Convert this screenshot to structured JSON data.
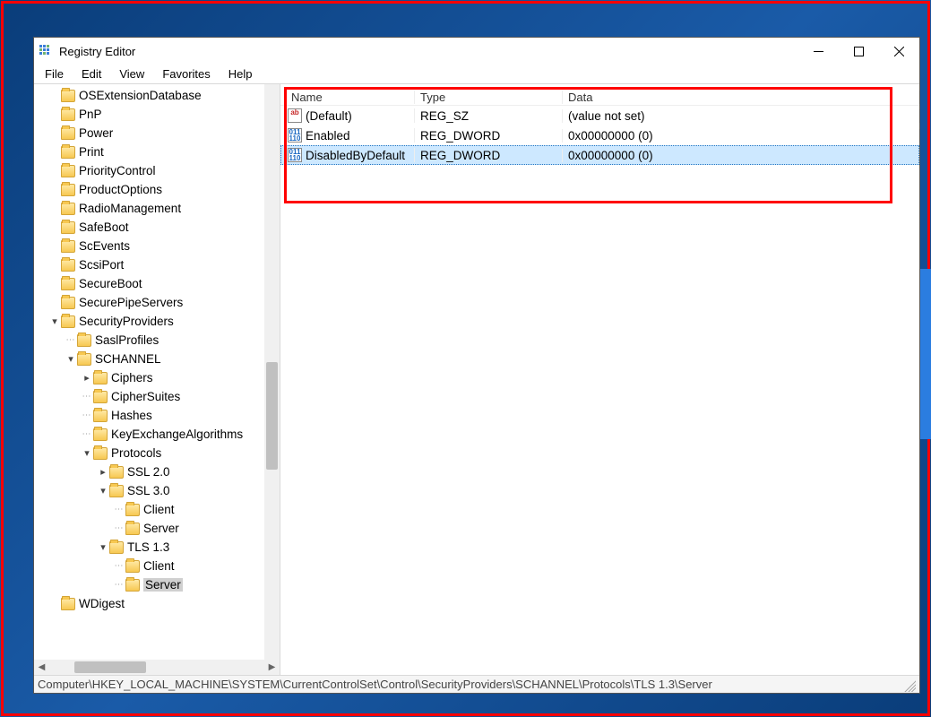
{
  "window": {
    "title": "Registry Editor"
  },
  "menu": {
    "file": "File",
    "edit": "Edit",
    "view": "View",
    "favorites": "Favorites",
    "help": "Help"
  },
  "tree": [
    {
      "indent": 0,
      "exp": "",
      "label": "OSExtensionDatabase"
    },
    {
      "indent": 0,
      "exp": "",
      "label": "PnP"
    },
    {
      "indent": 0,
      "exp": "",
      "label": "Power"
    },
    {
      "indent": 0,
      "exp": "",
      "label": "Print"
    },
    {
      "indent": 0,
      "exp": "",
      "label": "PriorityControl"
    },
    {
      "indent": 0,
      "exp": "",
      "label": "ProductOptions"
    },
    {
      "indent": 0,
      "exp": "",
      "label": "RadioManagement"
    },
    {
      "indent": 0,
      "exp": "",
      "label": "SafeBoot"
    },
    {
      "indent": 0,
      "exp": "",
      "label": "ScEvents"
    },
    {
      "indent": 0,
      "exp": "",
      "label": "ScsiPort"
    },
    {
      "indent": 0,
      "exp": "",
      "label": "SecureBoot"
    },
    {
      "indent": 0,
      "exp": "",
      "label": "SecurePipeServers"
    },
    {
      "indent": 0,
      "exp": "v",
      "label": "SecurityProviders"
    },
    {
      "indent": 1,
      "exp": "dot",
      "label": "SaslProfiles"
    },
    {
      "indent": 1,
      "exp": "v",
      "label": "SCHANNEL"
    },
    {
      "indent": 2,
      "exp": ">",
      "label": "Ciphers"
    },
    {
      "indent": 2,
      "exp": "dot",
      "label": "CipherSuites"
    },
    {
      "indent": 2,
      "exp": "dot",
      "label": "Hashes"
    },
    {
      "indent": 2,
      "exp": "dot",
      "label": "KeyExchangeAlgorithms"
    },
    {
      "indent": 2,
      "exp": "v",
      "label": "Protocols"
    },
    {
      "indent": 3,
      "exp": ">",
      "label": "SSL 2.0"
    },
    {
      "indent": 3,
      "exp": "v",
      "label": "SSL 3.0"
    },
    {
      "indent": 4,
      "exp": "dot",
      "label": "Client"
    },
    {
      "indent": 4,
      "exp": "dot",
      "label": "Server"
    },
    {
      "indent": 3,
      "exp": "v",
      "label": "TLS 1.3"
    },
    {
      "indent": 4,
      "exp": "dot",
      "label": "Client"
    },
    {
      "indent": 4,
      "exp": "dot",
      "label": "Server",
      "selected": true
    },
    {
      "indent": 0,
      "exp": "",
      "label": "WDigest"
    }
  ],
  "columns": {
    "name": "Name",
    "type": "Type",
    "data": "Data"
  },
  "values": [
    {
      "icon": "sz",
      "iconText": "ab",
      "name": "(Default)",
      "type": "REG_SZ",
      "data": "(value not set)",
      "selected": false
    },
    {
      "icon": "dw",
      "iconText": "011\n110",
      "name": "Enabled",
      "type": "REG_DWORD",
      "data": "0x00000000 (0)",
      "selected": false
    },
    {
      "icon": "dw",
      "iconText": "011\n110",
      "name": "DisabledByDefault",
      "type": "REG_DWORD",
      "data": "0x00000000 (0)",
      "selected": true
    }
  ],
  "status": {
    "path": "Computer\\HKEY_LOCAL_MACHINE\\SYSTEM\\CurrentControlSet\\Control\\SecurityProviders\\SCHANNEL\\Protocols\\TLS 1.3\\Server"
  }
}
